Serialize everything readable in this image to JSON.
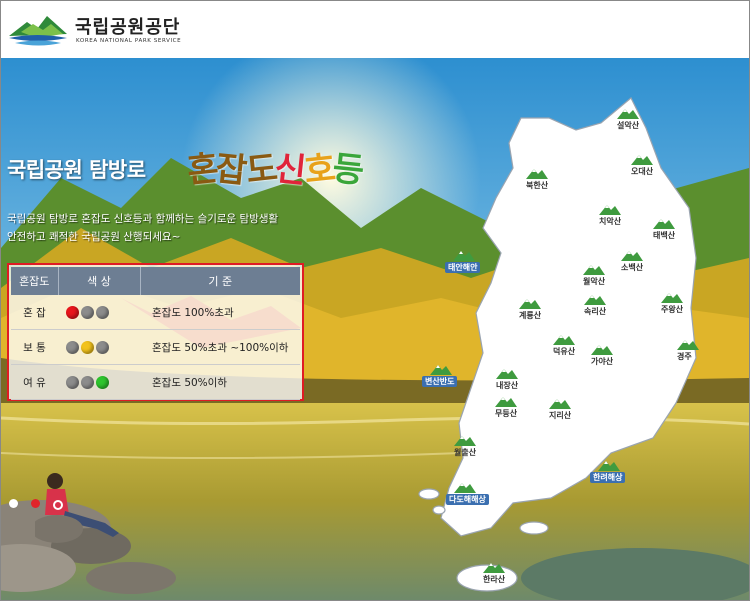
{
  "header": {
    "org_name_kr": "국립공원공단",
    "org_name_en": "KOREA NATIONAL PARK SERVICE"
  },
  "banner": {
    "title": "국립공원 탐방로",
    "title_emphasis": [
      "혼",
      "잡",
      "도",
      "신",
      "호",
      "등"
    ],
    "title_emphasis_colors": [
      "#8a5a12",
      "#8a5a12",
      "#8a5a12",
      "#e0243a",
      "#e8a21a",
      "#3aa63a"
    ],
    "description_line1": "국립공원 탐방로 혼잡도 신호등과 함께하는 슬기로운 탐방생활",
    "description_line2": "안전하고 쾌적한 국립공원 산행되세요~"
  },
  "legend": {
    "headers": [
      "혼잡도",
      "색 상",
      "기 준"
    ],
    "rows": [
      {
        "level": "혼 잡",
        "criteria": "혼잡도 100%초과",
        "lights": [
          "#e8161c",
          "#8c8c8c",
          "#8c8c8c"
        ]
      },
      {
        "level": "보 통",
        "criteria": "혼잡도 50%초과 ~100%이하",
        "lights": [
          "#8c8c8c",
          "#f2c21b",
          "#8c8c8c"
        ]
      },
      {
        "level": "여 유",
        "criteria": "혼잡도 50%이하",
        "lights": [
          "#8c8c8c",
          "#8c8c8c",
          "#2ec42e"
        ]
      }
    ]
  },
  "parks": [
    "설악산",
    "오대산",
    "북한산",
    "치악산",
    "태백산",
    "소백산",
    "월악산",
    "속리산",
    "계룡산",
    "주왕산",
    "덕유산",
    "가야산",
    "경주",
    "내장산",
    "무등산",
    "지리산",
    "월출산",
    "한라산"
  ],
  "sea_parks": [
    "태안해안",
    "변산반도",
    "한려해상",
    "다도해해상"
  ],
  "carousel": {
    "slides": 2,
    "active": 1
  },
  "colors": {
    "accent_red": "#e01b24",
    "table_header": "#6d7e93"
  }
}
